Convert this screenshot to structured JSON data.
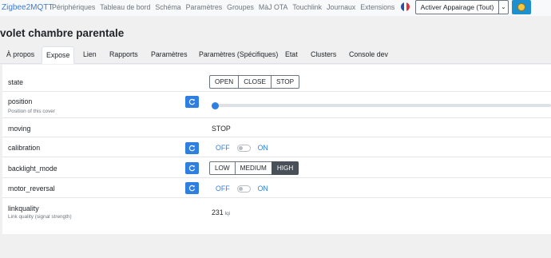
{
  "nav": {
    "brand": "Zigbee2MQTT",
    "links": [
      "Périphériques",
      "Tableau de bord",
      "Schéma",
      "Paramètres",
      "Groupes",
      "MàJ OTA",
      "Touchlink",
      "Journaux",
      "Extensions"
    ],
    "pair_button": "Activer Appairage (Tout)"
  },
  "page": {
    "title": "volet chambre parentale"
  },
  "tabs": [
    "À propos",
    "Expose",
    "Lien",
    "Rapports",
    "Paramètres",
    "Paramètres (Spécifiques)",
    "Etat",
    "Clusters",
    "Console dev"
  ],
  "exposes": {
    "state": {
      "label": "state",
      "options": [
        "OPEN",
        "CLOSE",
        "STOP"
      ]
    },
    "position": {
      "label": "position",
      "description": "Position of this cover",
      "value": 0
    },
    "moving": {
      "label": "moving",
      "value": "STOP"
    },
    "calibration": {
      "label": "calibration",
      "off": "OFF",
      "on": "ON"
    },
    "backlight_mode": {
      "label": "backlight_mode",
      "options": [
        "LOW",
        "MEDIUM",
        "HIGH"
      ],
      "selected": "HIGH"
    },
    "motor_reversal": {
      "label": "motor_reversal",
      "off": "OFF",
      "on": "ON"
    },
    "linkquality": {
      "label": "linkquality",
      "description": "Link quality (signal strength)",
      "value": "231",
      "unit": "lqi"
    }
  },
  "colors": {
    "accent": "#2f7fe0",
    "active_segment": "#495057"
  }
}
